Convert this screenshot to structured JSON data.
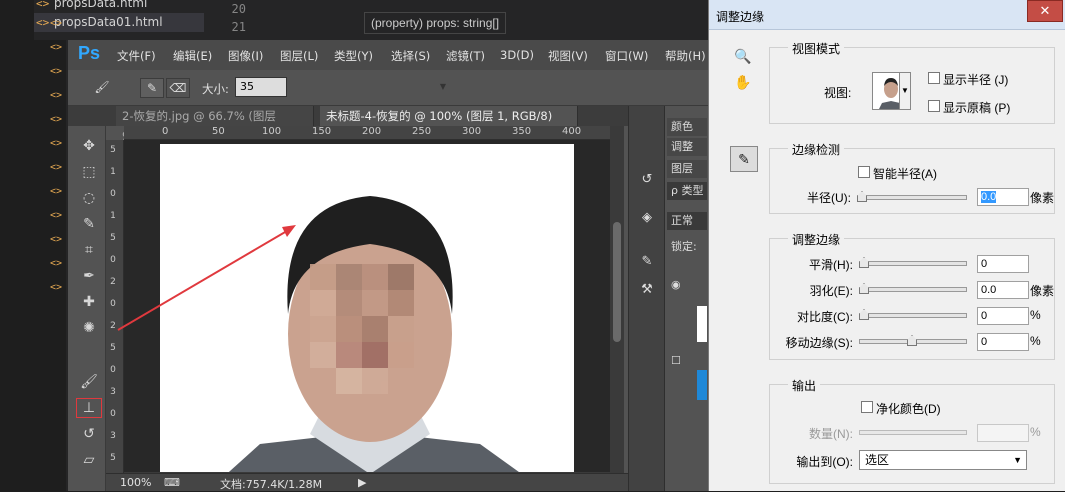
{
  "editor": {
    "files": [
      {
        "name": "propsData.html",
        "icon": "<>"
      },
      {
        "name": "propsData01.html",
        "icon": "<>"
      }
    ],
    "line_numbers": [
      "20",
      "21"
    ],
    "tooltip": "(property) props: string[]",
    "gutter_icon": "<>"
  },
  "ps": {
    "logo": "Ps",
    "menu": [
      "文件(F)",
      "编辑(E)",
      "图像(I)",
      "图层(L)",
      "类型(Y)",
      "选择(S)",
      "滤镜(T)",
      "3D(D)",
      "视图(V)",
      "窗口(W)",
      "帮助(H)"
    ],
    "options": {
      "size_label": "大小:",
      "size_value": "35"
    },
    "tabs": [
      {
        "label": "2-恢复的.jpg @ 66.7% (图层 9,...",
        "close": "×"
      },
      {
        "label": "未标题-4-恢复的 @ 100% (图层 1, RGB/8) *",
        "close": "×"
      }
    ],
    "ruler_top": [
      "0",
      "50",
      "100",
      "150",
      "200",
      "250",
      "300",
      "350",
      "400"
    ],
    "ruler_left": [
      "5",
      "1",
      "0",
      "1",
      "5",
      "0",
      "2",
      "0",
      "2",
      "5",
      "0",
      "3",
      "0",
      "3",
      "5"
    ],
    "status": {
      "zoom": "100%",
      "doc": "文档:757.4K/1.28M"
    },
    "panels": {
      "color": "颜色",
      "adjust": "调整",
      "layers": "图层",
      "search": "ρ 类型",
      "mode": "正常",
      "lock": "锁定:"
    }
  },
  "dialog": {
    "title": "调整边缘",
    "close": "✕",
    "view_mode": {
      "group": "视图模式",
      "view_label": "视图:",
      "show_radius": "显示半径 (J)",
      "show_original": "显示原稿 (P)"
    },
    "edge_detection": {
      "group": "边缘检测",
      "smart_radius": "智能半径(A)",
      "radius_label": "半径(U):",
      "radius_value": "0.0",
      "radius_unit": "像素",
      "radius_level": 0
    },
    "adjust_edge": {
      "group": "调整边缘",
      "rows": [
        {
          "label": "平滑(H):",
          "value": "0",
          "unit": "",
          "level": 0
        },
        {
          "label": "羽化(E):",
          "value": "0.0",
          "unit": "像素",
          "level": 0
        },
        {
          "label": "对比度(C):",
          "value": "0",
          "unit": "%",
          "level": 0
        },
        {
          "label": "移动边缘(S):",
          "value": "0",
          "unit": "%",
          "level": 0.5
        }
      ]
    },
    "output": {
      "group": "输出",
      "decontaminate": "净化颜色(D)",
      "amount_label": "数量(N):",
      "amount_unit": "%",
      "output_to_label": "输出到(O):",
      "output_to_value": "选区"
    }
  },
  "colors": {
    "annotation": "#e0393e",
    "ps_blue": "#31a8ff",
    "selection": "#3399ff"
  }
}
